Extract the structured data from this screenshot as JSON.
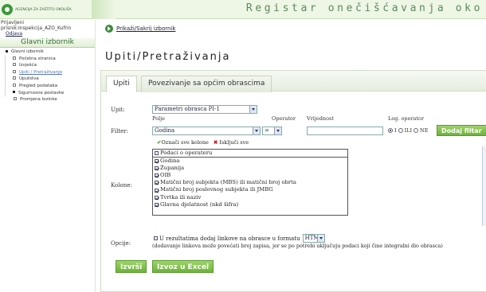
{
  "header": {
    "logo_text": "AGENCIJA ZA ZAŠTITU OKOLIŠA",
    "app_title": "Registar onečišćavanja oko"
  },
  "sidebar": {
    "login_line1": "Prijavljeni",
    "login_line2": "prisnik:Inspekcija_AZO_Kufrin",
    "logout": "Odjava",
    "menu_title": "Glavni izbornik",
    "items": [
      {
        "label": "Glavni izbornik"
      },
      {
        "label": "Početna stranica"
      },
      {
        "label": "Izvješća"
      },
      {
        "label": "Upiti / Pretraživanje"
      },
      {
        "label": "Uputstva"
      },
      {
        "label": "Pregled podataka"
      },
      {
        "label": "Sigurnosne postavke"
      },
      {
        "label": "Promjena lozinke"
      }
    ]
  },
  "breadcrumb": {
    "link": "Prikaži/Sakrij izbornik"
  },
  "page_title": "Upiti/Pretraživanja",
  "tabs": [
    {
      "label": "Upiti"
    },
    {
      "label": "Povezivanje sa općim obrascima"
    }
  ],
  "form": {
    "upit_label": "Upit:",
    "upit_value": "Parametri obrasca PI-1",
    "polje_label": "Polje",
    "operator_label": "Operator",
    "vrijednost_label": "Vrijednost",
    "logop_label": "Log. operator",
    "filter_label": "Filter:",
    "filter_field_value": "Godina",
    "filter_operator_value": "=",
    "radio_i": "I",
    "radio_ili": "ILI",
    "radio_ne": "NE",
    "add_filter_button": "Dodaj filtar",
    "kolone_label": "Kolone:",
    "select_all": "Označi sve kolone",
    "deselect_all": "Isključi sve",
    "columns": [
      {
        "label": "Podaci o operateru",
        "checked": false
      },
      {
        "label": "Godina",
        "checked": true
      },
      {
        "label": "Županija",
        "checked": true
      },
      {
        "label": "OIB",
        "checked": true
      },
      {
        "label": "Matični broj subjekta (MBS) ili matični broj obrta",
        "checked": true
      },
      {
        "label": "Matični broj poslovnog subjekta ili JMBG",
        "checked": true
      },
      {
        "label": "Tvrtka ili naziv",
        "checked": true
      },
      {
        "label": "Glavna djelatnost (nkd šifra)",
        "checked": true
      }
    ],
    "opcije_label": "Opcije:",
    "opcije_text": "U rezultatima dodaj linkove na obrasce u formatu",
    "format_value": "HTM",
    "opcije_note": "(dodavanje linkova može povećati broj zapisa, jer se po potrebi uključuju podaci koji čine integralni dio obrasca)",
    "execute_button": "Izvrši",
    "export_button": "Izvoz u Excel"
  }
}
